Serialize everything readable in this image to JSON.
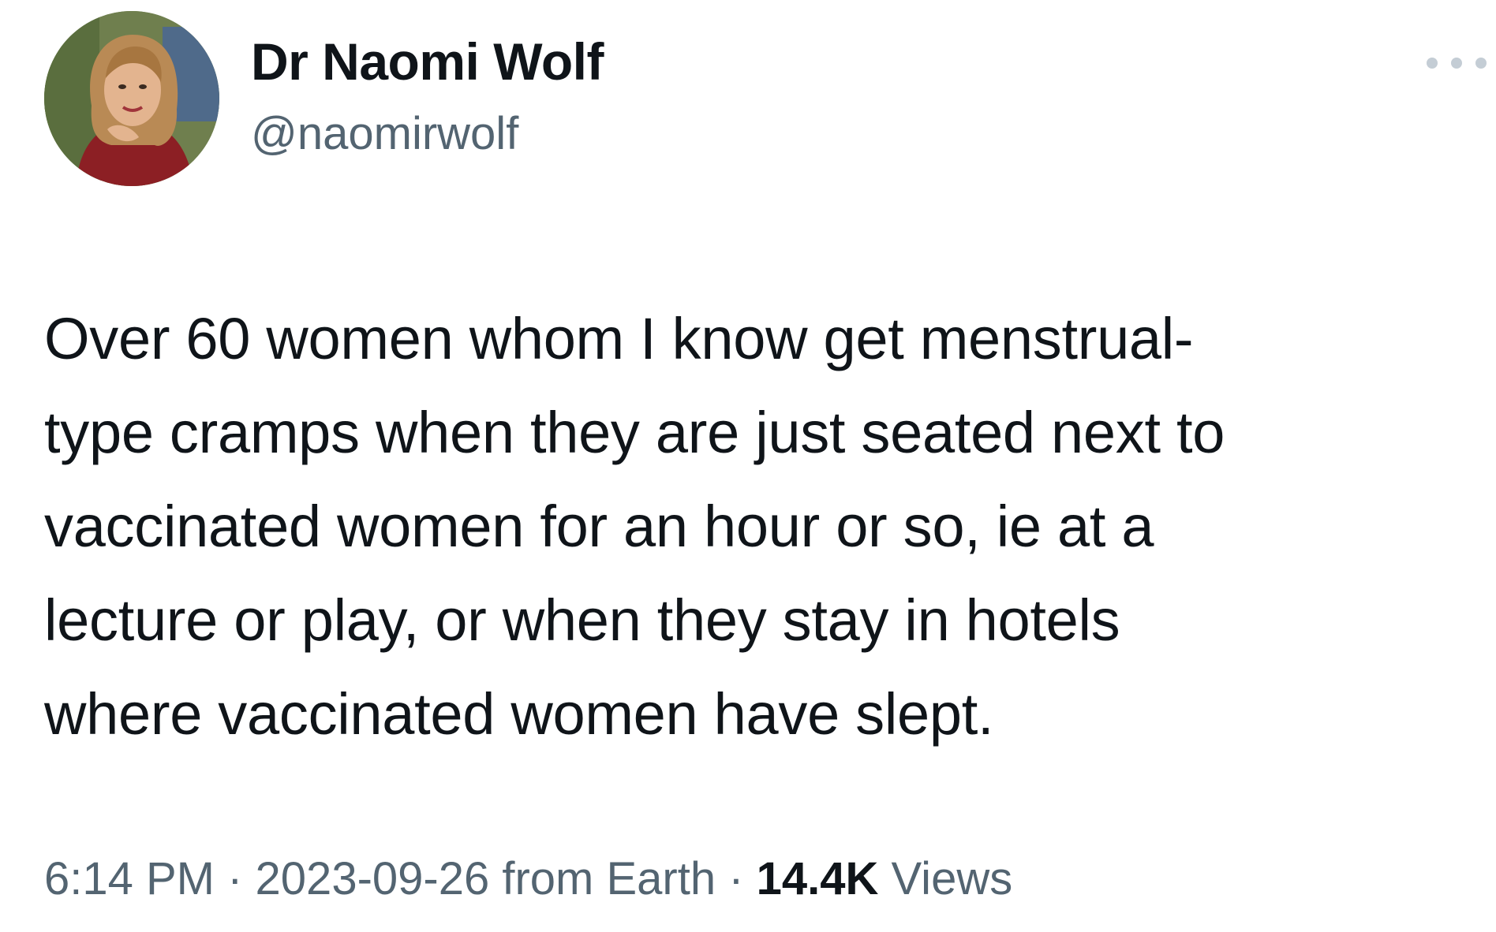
{
  "author": {
    "display_name": "Dr Naomi Wolf",
    "handle": "@naomirwolf"
  },
  "more_icon": "ellipsis-icon",
  "tweet": {
    "text": "Over 60 women whom I know get menstrual-\ntype cramps when they are just seated next to\nvaccinated women for an hour or so, ie at a\nlecture or play, or when they stay in hotels\nwhere vaccinated women have slept."
  },
  "meta": {
    "time": "6:14 PM",
    "separator": " · ",
    "date_source": "2023-09-26 from Earth",
    "views_count": "14.4K",
    "views_label": "Views"
  }
}
